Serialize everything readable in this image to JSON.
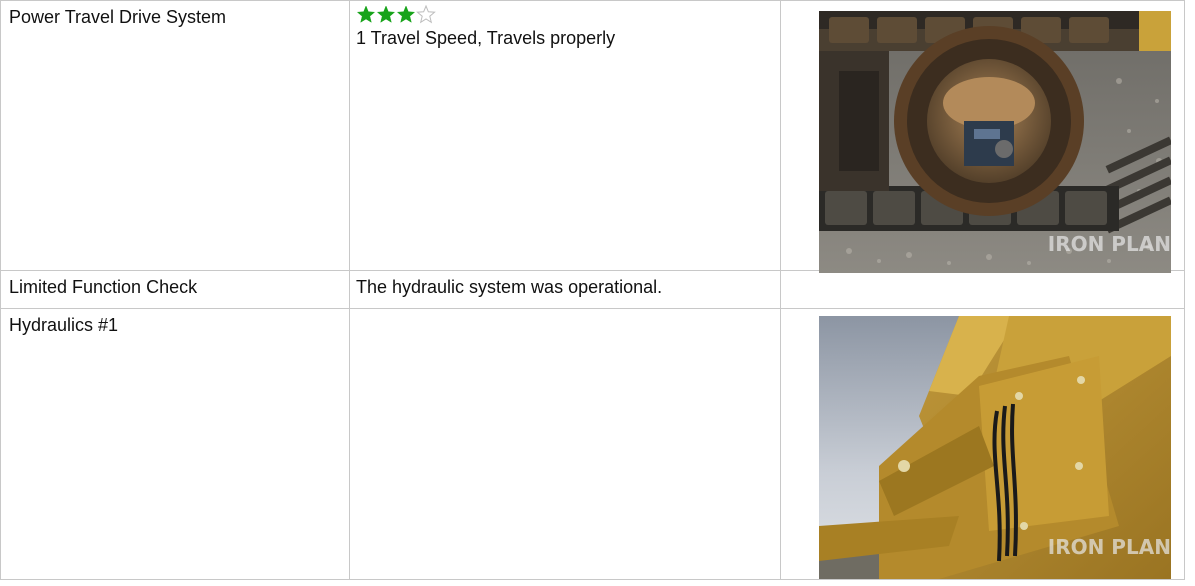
{
  "rows": [
    {
      "name": "Power Travel Drive System",
      "rating": {
        "value": 3,
        "max": 4,
        "filled_color": "#17a31a",
        "empty_color": "#bdbdbd"
      },
      "description": "1 Travel Speed, Travels properly",
      "photo": {
        "icon": "excavator-track-drive-photo",
        "watermark": "IRON PLANET"
      }
    },
    {
      "name": "Limited Function Check",
      "description": "The hydraulic system was operational."
    },
    {
      "name": "Hydraulics #1",
      "description": "",
      "photo": {
        "icon": "hydraulic-boom-photo",
        "watermark": "IRON PLANET"
      }
    }
  ]
}
